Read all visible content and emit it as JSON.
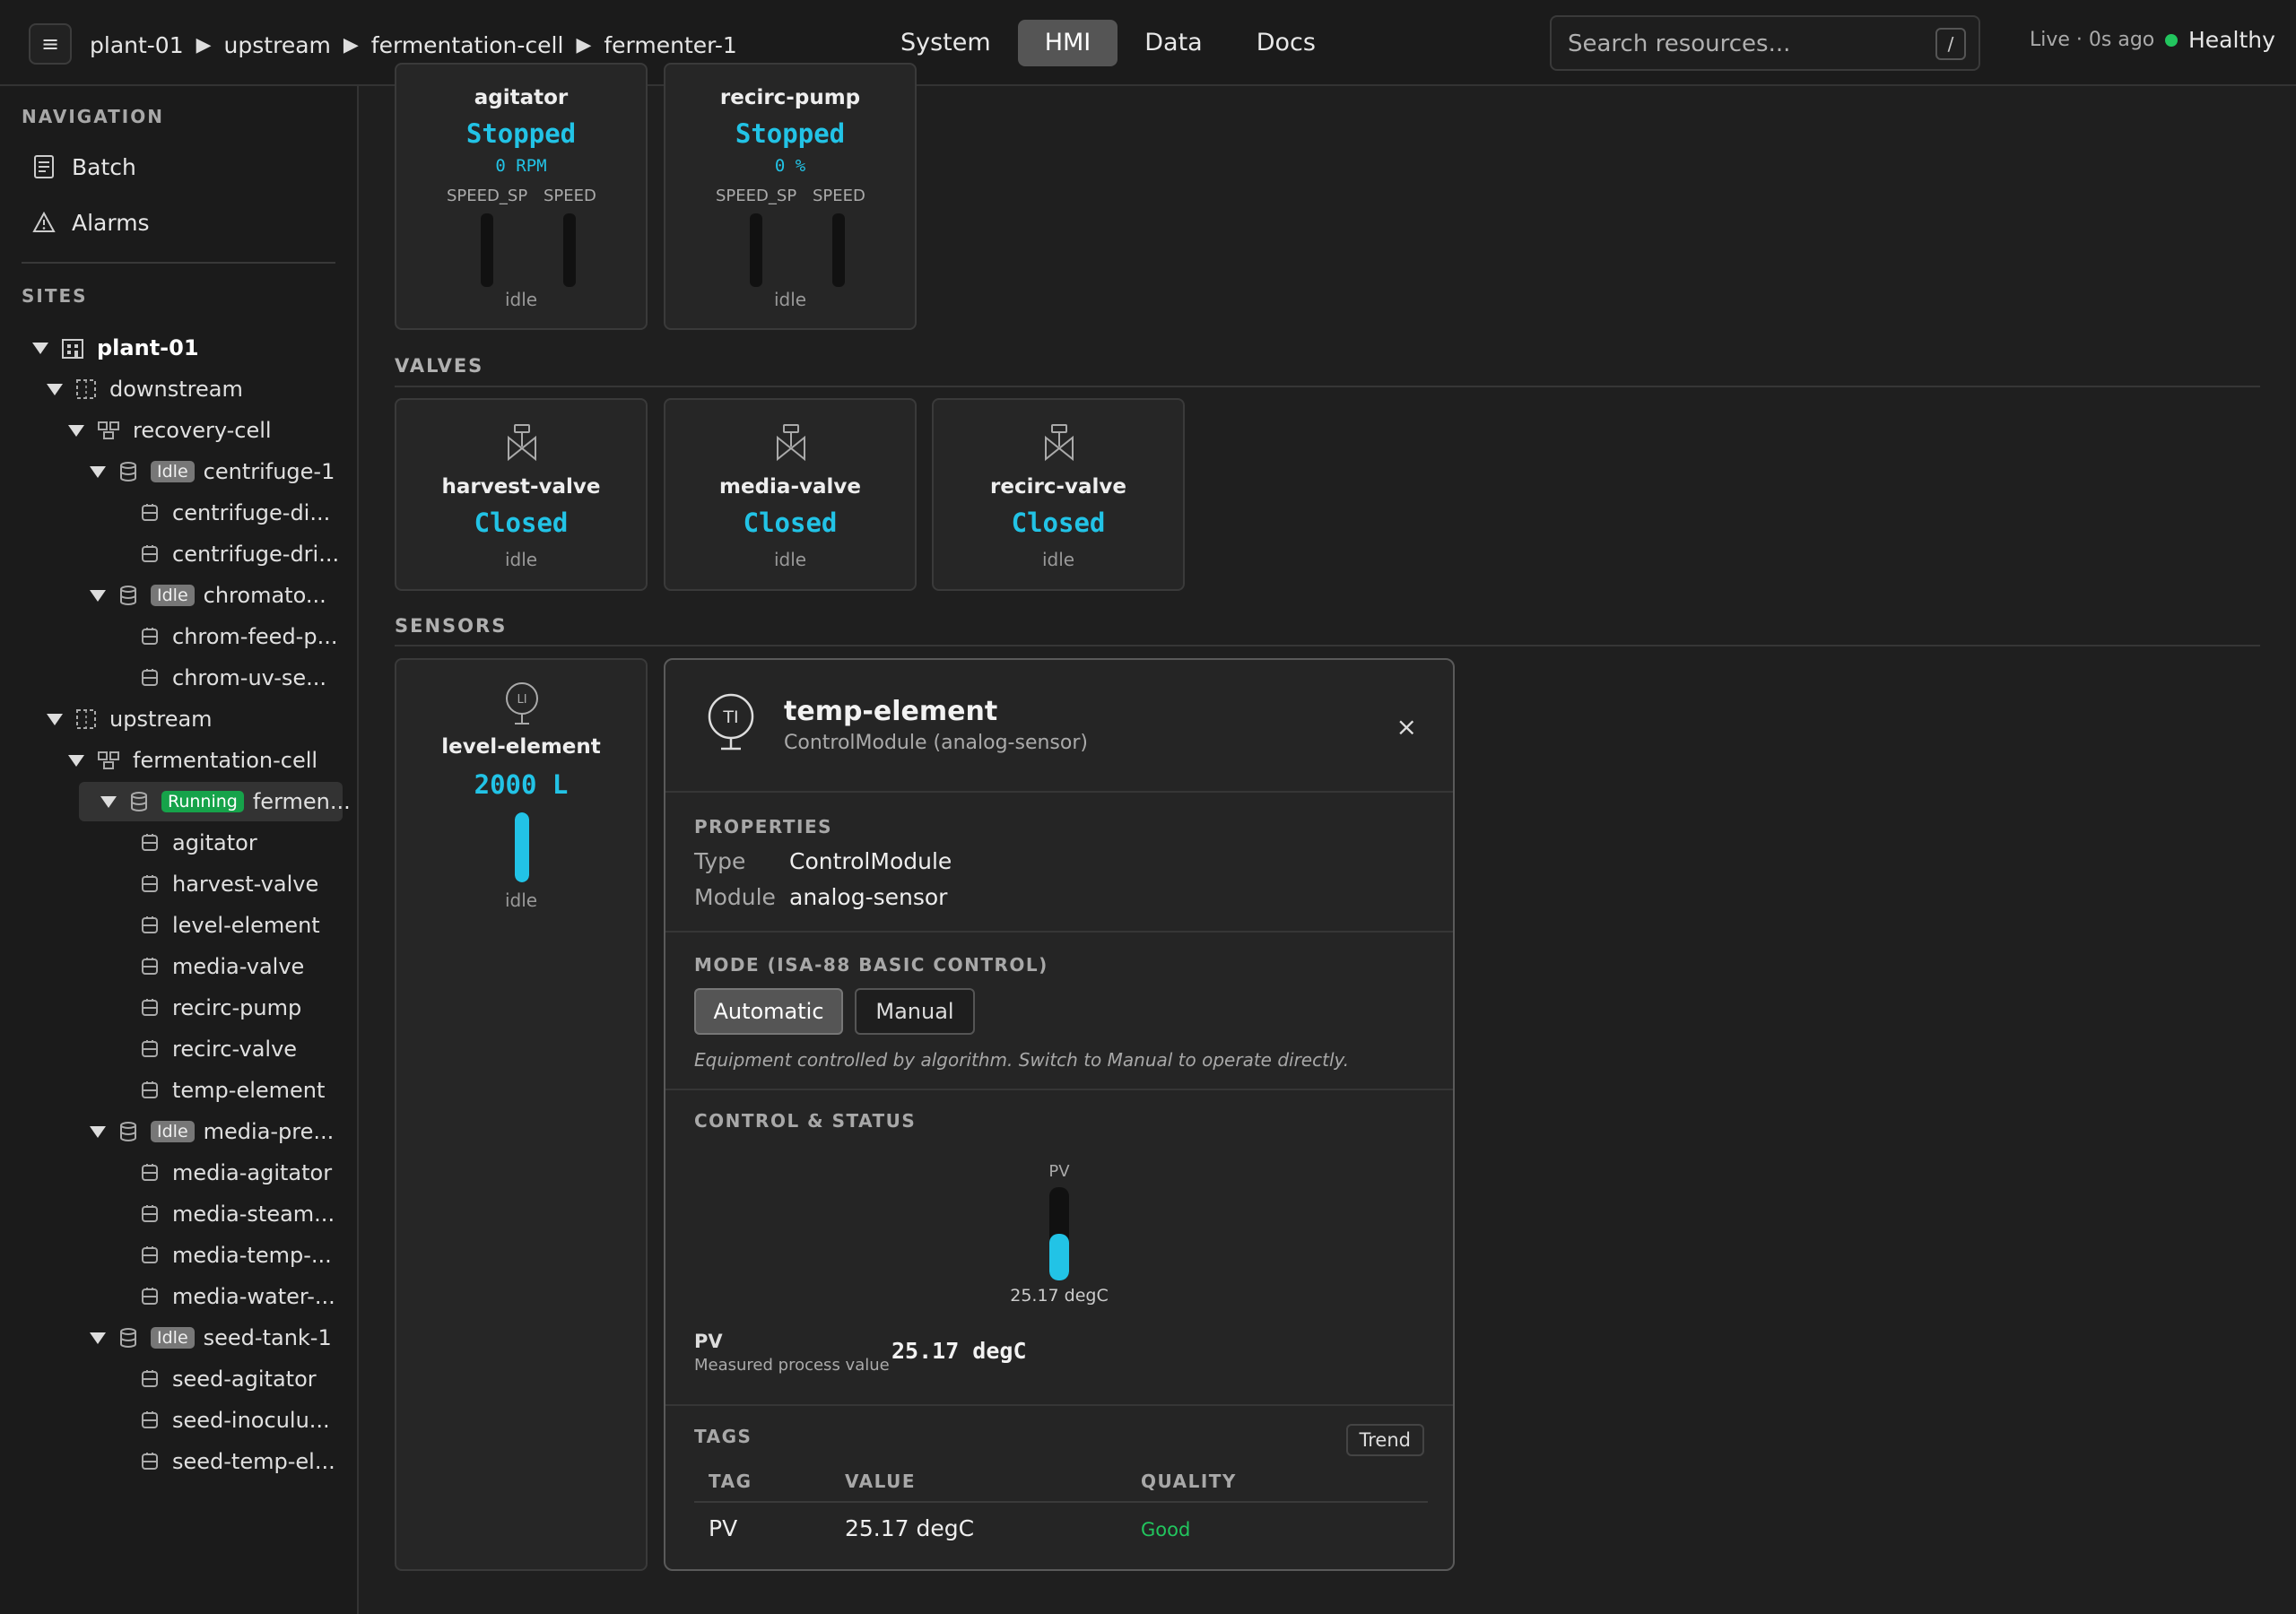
{
  "topbar": {
    "menu_glyph": "≡",
    "breadcrumb": [
      "plant-01",
      "upstream",
      "fermentation-cell",
      "fermenter-1"
    ],
    "tabs": [
      "System",
      "HMI",
      "Data",
      "Docs"
    ],
    "active_tab": "HMI",
    "search_placeholder": "Search resources...",
    "search_shortcut": "/",
    "live_status": "Live · 0s ago",
    "health": "Healthy",
    "health_color": "#22c55e"
  },
  "sidebar": {
    "nav_heading": "NAVIGATION",
    "nav_items": [
      "Batch",
      "Alarms"
    ],
    "sites_heading": "SITES",
    "tree": [
      {
        "label": "plant-01"
      },
      {
        "label": "downstream"
      },
      {
        "label": "recovery-cell"
      },
      {
        "label": "centrifuge-1",
        "badge": "Idle"
      },
      {
        "label": "centrifuge-di..."
      },
      {
        "label": "centrifuge-dri..."
      },
      {
        "label": "chromato...",
        "badge": "Idle"
      },
      {
        "label": "chrom-feed-p..."
      },
      {
        "label": "chrom-uv-se..."
      },
      {
        "label": "upstream"
      },
      {
        "label": "fermentation-cell"
      },
      {
        "label": "fermen...",
        "badge": "Running"
      },
      {
        "label": "agitator"
      },
      {
        "label": "harvest-valve"
      },
      {
        "label": "level-element"
      },
      {
        "label": "media-valve"
      },
      {
        "label": "recirc-pump"
      },
      {
        "label": "recirc-valve"
      },
      {
        "label": "temp-element"
      },
      {
        "label": "media-pre...",
        "badge": "Idle"
      },
      {
        "label": "media-agitator"
      },
      {
        "label": "media-steam..."
      },
      {
        "label": "media-temp-..."
      },
      {
        "label": "media-water-..."
      },
      {
        "label": "seed-tank-1",
        "badge": "Idle"
      },
      {
        "label": "seed-agitator"
      },
      {
        "label": "seed-inoculu..."
      },
      {
        "label": "seed-temp-el..."
      }
    ]
  },
  "motors": [
    {
      "name": "agitator",
      "state": "Stopped",
      "reading": "0 RPM",
      "sp_label": "SPEED_SP",
      "pv_label": "SPEED",
      "status": "idle"
    },
    {
      "name": "recirc-pump",
      "state": "Stopped",
      "reading": "0 %",
      "sp_label": "SPEED_SP",
      "pv_label": "SPEED",
      "status": "idle"
    }
  ],
  "valves_heading": "VALVES",
  "valves": [
    {
      "name": "harvest-valve",
      "state": "Closed",
      "status": "idle"
    },
    {
      "name": "media-valve",
      "state": "Closed",
      "status": "idle"
    },
    {
      "name": "recirc-valve",
      "state": "Closed",
      "status": "idle"
    }
  ],
  "sensors_heading": "SENSORS",
  "sensor": {
    "icon_text": "LI",
    "name": "level-element",
    "value": "2000 L",
    "status": "idle",
    "fill_fraction": 1.0
  },
  "accent_color": "#22c3e6",
  "modal": {
    "icon_text": "TI",
    "title": "temp-element",
    "subtitle": "ControlModule (analog-sensor)",
    "close_glyph": "×",
    "properties_heading": "PROPERTIES",
    "properties": [
      {
        "key": "Type",
        "value": "ControlModule"
      },
      {
        "key": "Module",
        "value": "analog-sensor"
      }
    ],
    "mode_heading": "MODE (ISA-88 BASIC CONTROL)",
    "mode_options": [
      "Automatic",
      "Manual"
    ],
    "mode_selected": "Automatic",
    "mode_hint": "Equipment controlled by algorithm. Switch to Manual to operate directly.",
    "control_heading": "CONTROL & STATUS",
    "gauge_label": "PV",
    "gauge_value": "25.17 degC",
    "gauge_fill_fraction": 0.5,
    "pv_label": "PV",
    "pv_desc": "Measured process value",
    "pv_value": "25.17 degC",
    "tags_heading": "TAGS",
    "trend_label": "Trend",
    "table_headers": [
      "TAG",
      "VALUE",
      "QUALITY"
    ],
    "table_rows": [
      {
        "tag": "PV",
        "value": "25.17 degC",
        "quality": "Good"
      }
    ],
    "quality_good_color": "#22c55e"
  }
}
